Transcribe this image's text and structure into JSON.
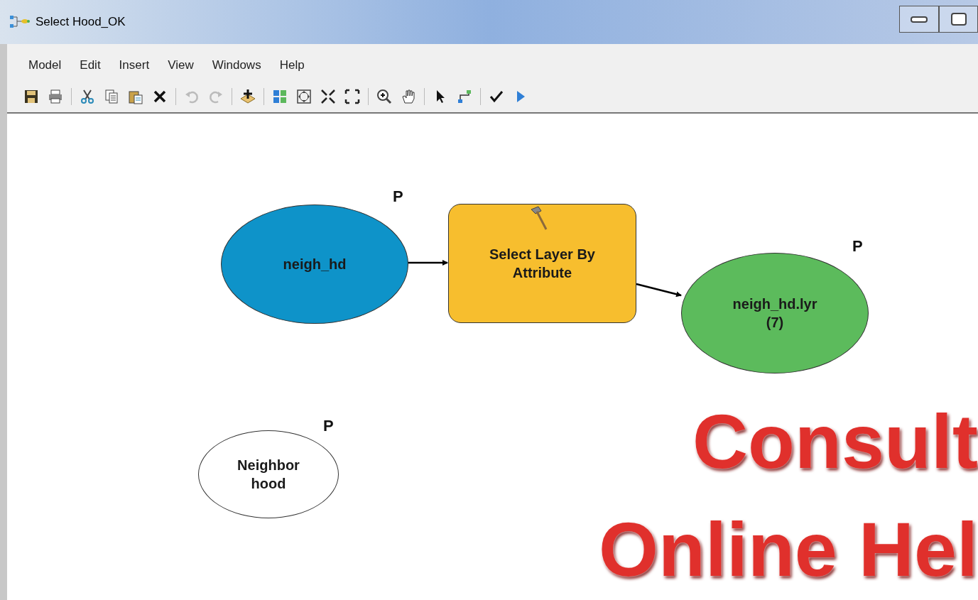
{
  "window": {
    "title": "Select Hood_OK"
  },
  "menu": [
    "Model",
    "Edit",
    "Insert",
    "View",
    "Windows",
    "Help"
  ],
  "nodes": [
    {
      "kind": "ellipse",
      "label": "neigh_hd",
      "color": "#0e93c9",
      "parameter_mark": "P"
    },
    {
      "kind": "tool",
      "label": "Select Layer By Attribute",
      "color": "#f7be2e"
    },
    {
      "kind": "ellipse",
      "label": "neigh_hd.lyr (7)",
      "color": "#5cbb5c",
      "parameter_mark": "P"
    },
    {
      "kind": "ellipse",
      "label": "Neighbor hood",
      "color": "#ffffff",
      "parameter_mark": "P"
    }
  ],
  "overlay": [
    "Consult",
    "Online Hel"
  ]
}
